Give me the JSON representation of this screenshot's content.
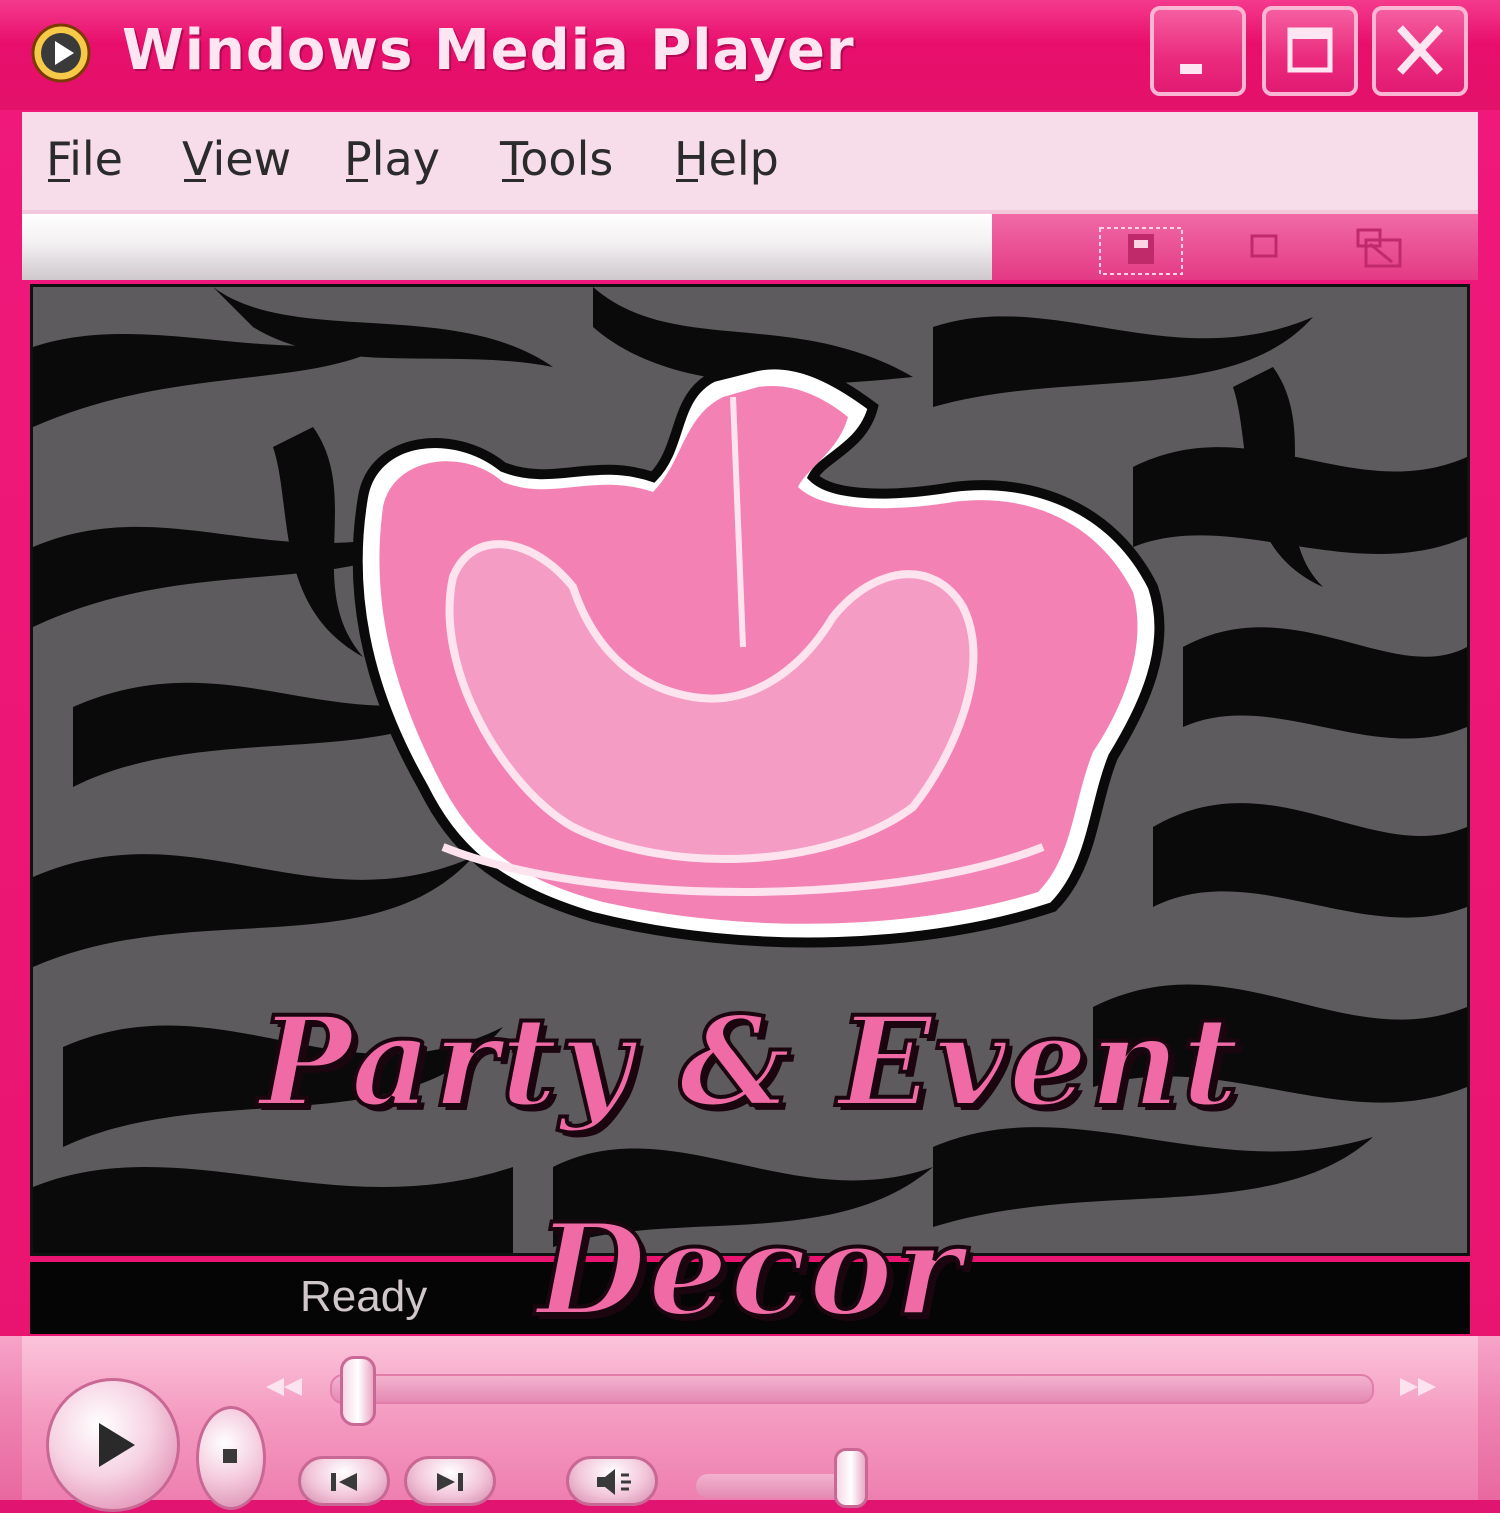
{
  "window": {
    "title": "Windows Media Player",
    "icon": "media-player-icon",
    "controls": [
      "minimize-icon",
      "maximize-icon",
      "close-icon"
    ]
  },
  "menu": {
    "items": [
      {
        "label": "File"
      },
      {
        "label": "View"
      },
      {
        "label": "Play"
      },
      {
        "label": "Tools"
      },
      {
        "label": "Help"
      }
    ]
  },
  "toolbar": {
    "icons": [
      "compact-mode-icon",
      "skin-mode-icon",
      "fullscreen-icon"
    ]
  },
  "status": {
    "text": "Ready"
  },
  "overlay": {
    "line1": "Party & Event",
    "line2": "Decor"
  },
  "player_controls": {
    "icons": [
      "play-icon",
      "stop-icon",
      "previous-icon",
      "next-icon",
      "mute-icon",
      "rewind-icon",
      "fast-forward-icon"
    ],
    "seek_position": 0.0,
    "volume_level": 0.85
  },
  "colors": {
    "chrome_pink": "#e8146f",
    "menu_bg": "#f6dde9",
    "crown_pink": "#f481b4",
    "headline_pink": "#f06aa6",
    "zebra_dark": "#0a0a0a",
    "zebra_light": "#5d5b5d"
  }
}
